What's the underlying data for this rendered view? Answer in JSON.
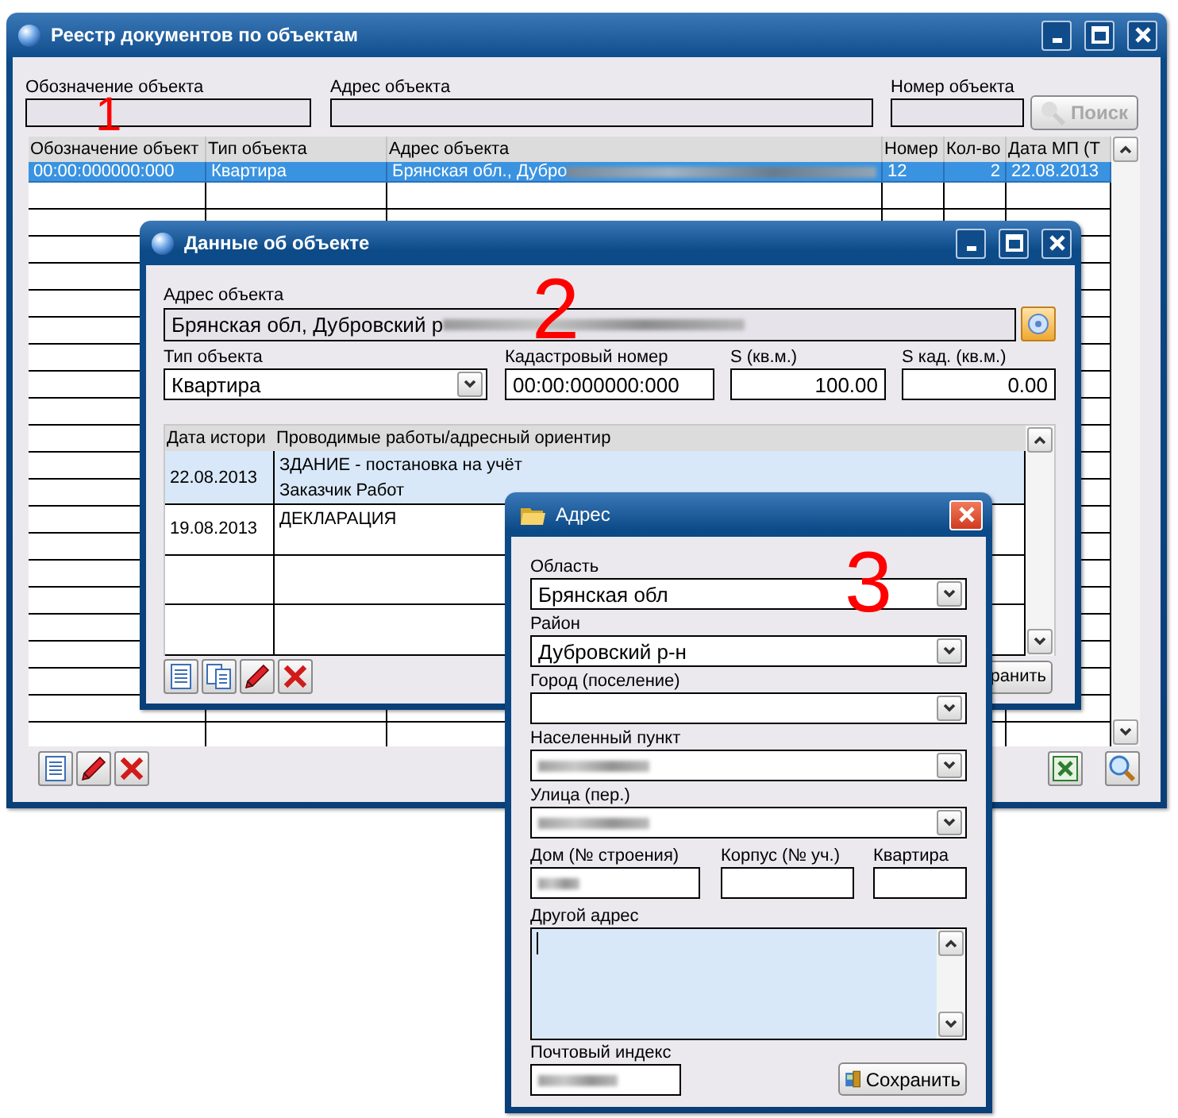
{
  "registry_window": {
    "title": "Реестр документов по объектам",
    "filters": [
      {
        "label": "Обозначение объекта"
      },
      {
        "label": "Адрес объекта"
      },
      {
        "label": "Номер объекта"
      }
    ],
    "search_button": {
      "label": "Поиск",
      "disabled": true
    },
    "table": {
      "columns": [
        "Обозначение объект",
        "Тип объекта",
        "Адрес объекта",
        "Номер",
        "Кол-во",
        "Дата МП (Т"
      ],
      "rows": [
        {
          "cells": [
            "00:00:000000:000",
            "Квартира",
            "Брянская обл., Дубро",
            "12",
            "2",
            "22.08.2013"
          ],
          "address_redacted": true,
          "selected": true
        }
      ]
    }
  },
  "object_window": {
    "title": "Данные об объекте",
    "address": {
      "label": "Адрес объекта",
      "value": "Брянская обл, Дубровский р",
      "redacted": true
    },
    "fields": [
      {
        "kind": "combo",
        "label": "Тип объекта",
        "value": "Квартира"
      },
      {
        "kind": "text",
        "label": "Кадастровый номер",
        "value": "00:00:000000:000"
      },
      {
        "kind": "number",
        "label": "S (кв.м.)",
        "value": "100.00"
      },
      {
        "kind": "number",
        "label": "S кад. (кв.м.)",
        "value": "0.00"
      }
    ],
    "history": {
      "columns": [
        "Дата истори",
        "Проводимые работы/адресный ориентир"
      ],
      "rows": [
        {
          "date": "22.08.2013",
          "lines": [
            "ЗДАНИЕ - постановка на учёт",
            "Заказчик Работ"
          ],
          "selected": true
        },
        {
          "date": "19.08.2013",
          "lines": [
            "ДЕКЛАРАЦИЯ"
          ],
          "selected": false
        }
      ]
    },
    "save_button": {
      "label": "ранить"
    }
  },
  "address_dialog": {
    "title": "Адрес",
    "combos": [
      {
        "label": "Область",
        "value": "Брянская обл",
        "redacted": false
      },
      {
        "label": "Район",
        "value": "Дубровский р-н",
        "redacted": false
      },
      {
        "label": "Город (поселение)",
        "redacted": false
      },
      {
        "label": "Населенный пункт",
        "redacted": true
      },
      {
        "label": "Улица (пер.)",
        "redacted": true
      }
    ],
    "house_fields": [
      {
        "label": "Дом (№ строения)",
        "redacted": true
      },
      {
        "label": "Корпус (№ уч.)",
        "redacted": false
      },
      {
        "label": "Квартира",
        "redacted": false
      }
    ],
    "other_address": {
      "label": "Другой адрес"
    },
    "postal_code": {
      "label": "Почтовый индекс",
      "redacted": true
    },
    "save_button": {
      "label": "Сохранить"
    }
  },
  "annotations": [
    {
      "text": "1"
    },
    {
      "text": "2"
    },
    {
      "text": "3"
    }
  ]
}
